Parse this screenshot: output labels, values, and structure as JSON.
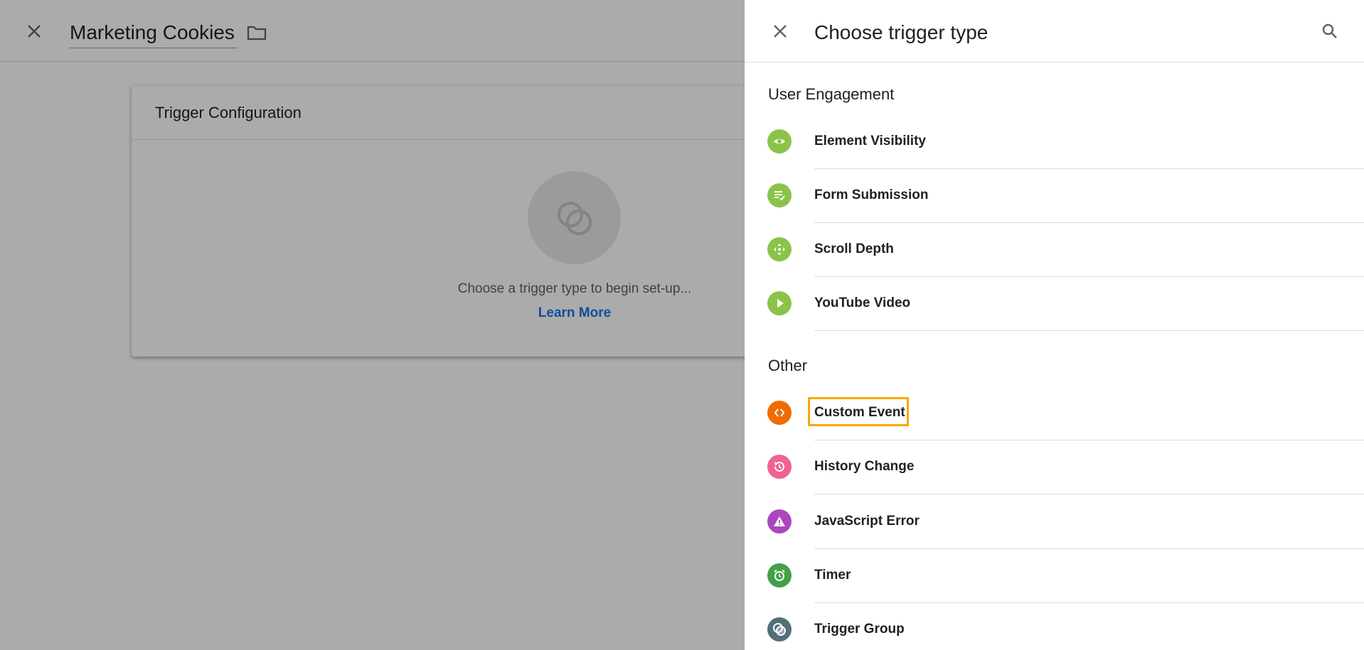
{
  "editor": {
    "title": "Marketing Cookies",
    "card": {
      "title": "Trigger Configuration",
      "hint": "Choose a trigger type to begin set-up...",
      "learn_more": "Learn More"
    }
  },
  "panel": {
    "title": "Choose trigger type",
    "sections": [
      {
        "title": "User Engagement",
        "items": [
          {
            "label": "Element Visibility",
            "icon": "eye-icon",
            "color": "#8bc34a"
          },
          {
            "label": "Form Submission",
            "icon": "form-check-icon",
            "color": "#8bc34a"
          },
          {
            "label": "Scroll Depth",
            "icon": "move-arrows-icon",
            "color": "#8bc34a"
          },
          {
            "label": "YouTube Video",
            "icon": "play-icon",
            "color": "#8bc34a"
          }
        ]
      },
      {
        "title": "Other",
        "items": [
          {
            "label": "Custom Event",
            "icon": "code-brackets-icon",
            "color": "#ef6c00"
          },
          {
            "label": "History Change",
            "icon": "history-icon",
            "color": "#f06292"
          },
          {
            "label": "JavaScript Error",
            "icon": "warning-icon",
            "color": "#ab47bc"
          },
          {
            "label": "Timer",
            "icon": "alarm-clock-icon",
            "color": "#43a047"
          },
          {
            "label": "Trigger Group",
            "icon": "trigger-group-icon",
            "color": "#546e7a"
          }
        ]
      }
    ]
  },
  "colors": {
    "accent_link": "#1a73e8",
    "highlight_border": "#f5a800"
  }
}
